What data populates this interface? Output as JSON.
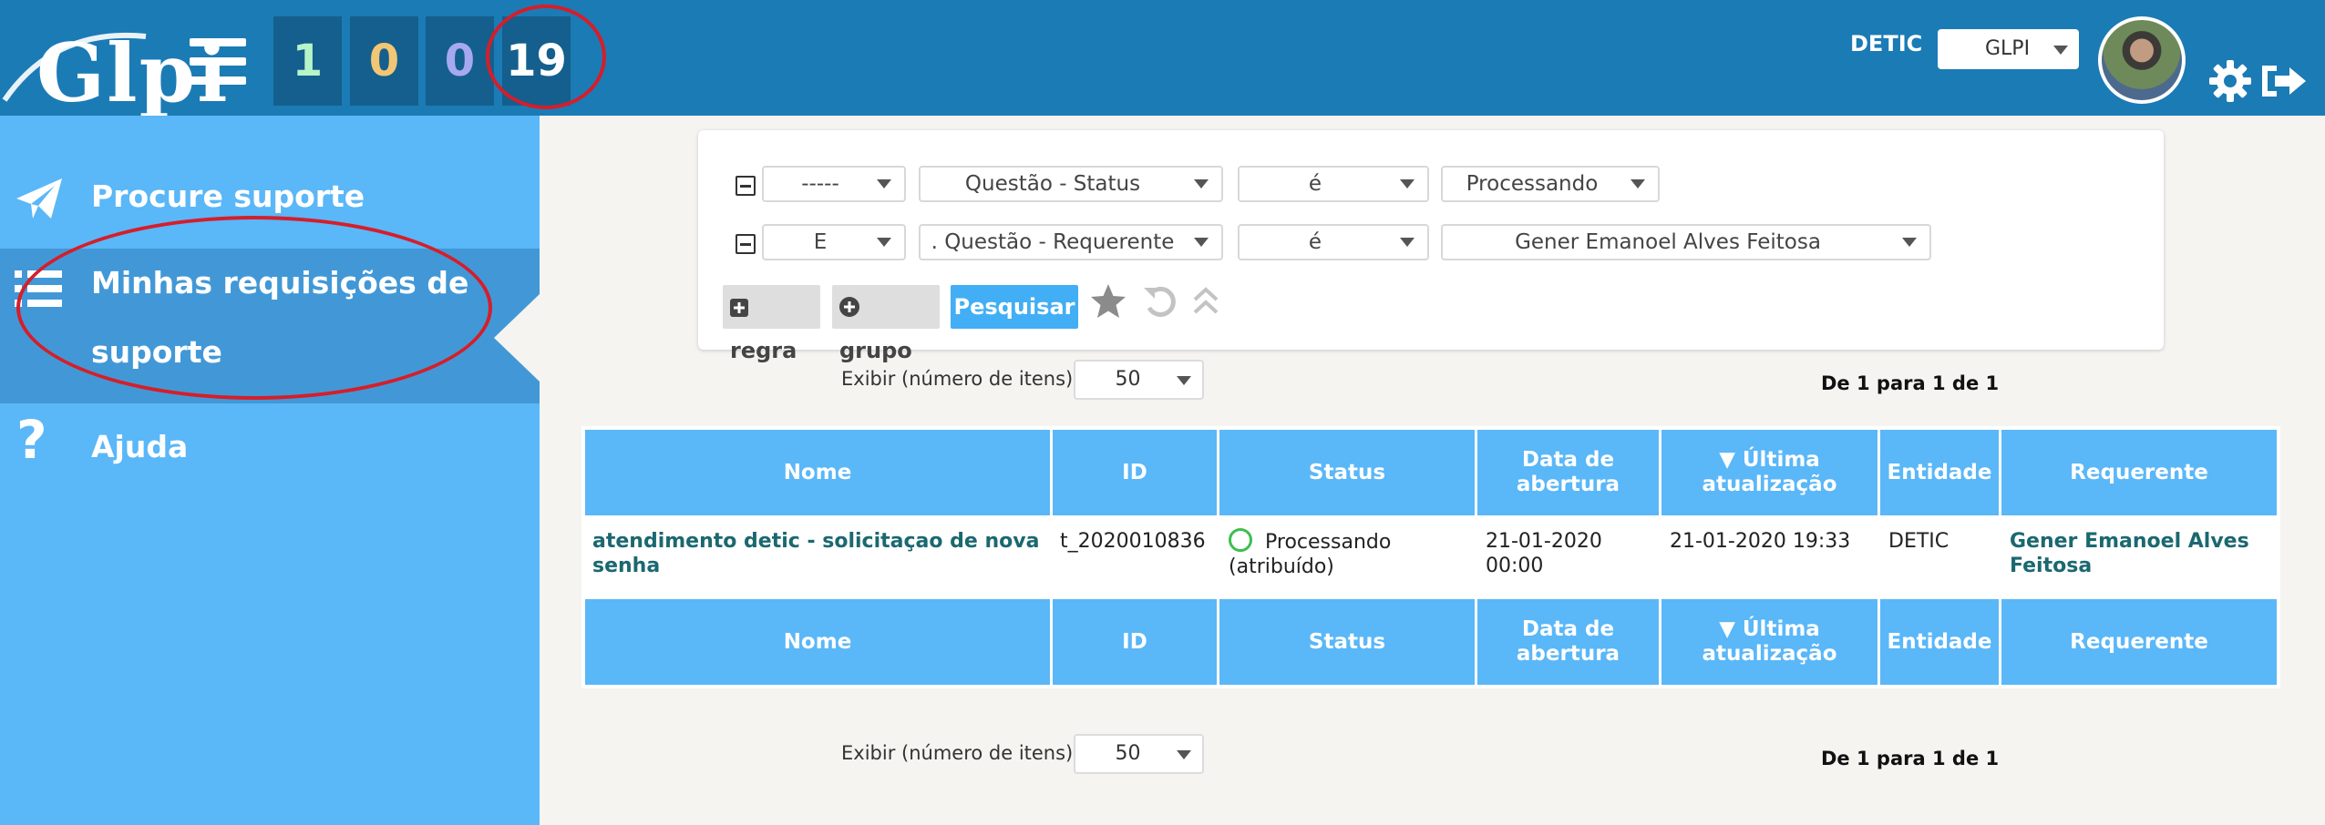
{
  "header": {
    "logo_text": "Glpi",
    "counters": [
      "1",
      "0",
      "0",
      "19"
    ],
    "entity_label": "DETIC",
    "entity_select": "GLPI"
  },
  "sidebar": {
    "items": [
      {
        "label": "Procure suporte",
        "icon": "paper-plane-icon"
      },
      {
        "label": "Minhas requisições de suporte",
        "icon": "list-icon"
      },
      {
        "label": "Ajuda",
        "icon": "question-icon"
      }
    ]
  },
  "search": {
    "row1": {
      "link": "-----",
      "field": "Questão - Status",
      "operator": "é",
      "value": "Processando"
    },
    "row2": {
      "link": "E",
      "field": ". Questão - Requerente",
      "operator": "é",
      "value": "Gener Emanoel Alves Feitosa"
    },
    "buttons": {
      "rule": "regra",
      "group": "grupo",
      "search": "Pesquisar"
    }
  },
  "pagination": {
    "label": "Exibir (número de itens)",
    "value": "50",
    "info_prefix": "De ",
    "info_from": "1",
    "info_mid": " para ",
    "info_to": "1",
    "info_of": " de ",
    "info_total": "1"
  },
  "table": {
    "columns": [
      "Nome",
      "ID",
      "Status",
      "Data de abertura",
      "▼ Última atualização",
      "Entidade",
      "Requerente"
    ],
    "rows": [
      {
        "nome": "atendimento detic - solicitaçao de nova senha",
        "id": "t_2020010836",
        "status": "Processando (atribuído)",
        "data_abertura": "21-01-2020 00:00",
        "ultima_atualizacao": "21-01-2020 19:33",
        "entidade": "DETIC",
        "requerente": "Gener Emanoel Alves Feitosa"
      }
    ]
  }
}
